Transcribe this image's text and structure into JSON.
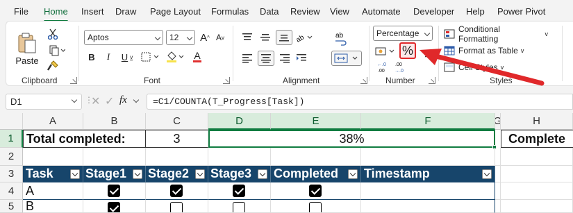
{
  "menu": {
    "tabs": [
      "File",
      "Home",
      "Insert",
      "Draw",
      "Page Layout",
      "Formulas",
      "Data",
      "Review",
      "View",
      "Automate",
      "Developer",
      "Help",
      "Power Pivot"
    ],
    "active": "Home"
  },
  "clipboard": {
    "paste_label": "Paste",
    "group_label": "Clipboard"
  },
  "font": {
    "name": "Aptos",
    "size": "12",
    "group_label": "Font",
    "bold": "B",
    "italic": "I",
    "underline": "U",
    "font_color_letter": "A",
    "grow": "A",
    "shrink": "A",
    "font_color_hex": "#e03030"
  },
  "alignment": {
    "group_label": "Alignment"
  },
  "number": {
    "format": "Percentage",
    "percent_symbol": "%",
    "comma_symbol": ",",
    "group_label": "Number",
    "inc_decimal": ".0→.00",
    "dec_decimal": ".00→.0"
  },
  "styles": {
    "conditional_formatting": "Conditional Formatting",
    "format_as_table": "Format as Table",
    "cell_styles": "Cell Styles",
    "group_label": "Styles"
  },
  "formula_bar": {
    "name_box": "D1",
    "fx": "fx",
    "formula": "=C1/COUNTA(T_Progress[Task])"
  },
  "grid": {
    "columns": [
      "A",
      "B",
      "C",
      "D",
      "E",
      "F",
      "G",
      "H"
    ],
    "rows": [
      "1",
      "2",
      "3",
      "4",
      "5"
    ],
    "row1": {
      "a": "Total completed:",
      "c": "3",
      "def": "38%",
      "h": "Complete"
    },
    "table_headers": [
      "Task",
      "Stage1",
      "Stage2",
      "Stage3",
      "Completed",
      "Timestamp"
    ],
    "table_rows": [
      {
        "task": "A",
        "stage1": true,
        "stage2": true,
        "stage3": true,
        "completed": true
      },
      {
        "task": "B",
        "stage1": true,
        "stage2": false,
        "stage3": false,
        "completed": false
      }
    ]
  },
  "colors": {
    "accent_green": "#107c41",
    "table_header": "#17456b",
    "arrow_red": "#e0282a"
  }
}
